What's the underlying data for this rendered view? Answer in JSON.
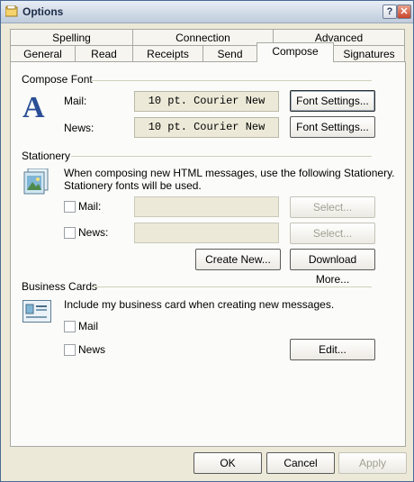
{
  "window": {
    "title": "Options",
    "help_glyph": "?",
    "close_glyph": "✕"
  },
  "tabs": {
    "row1": [
      "Spelling",
      "Connection",
      "Advanced"
    ],
    "row2": [
      "General",
      "Read",
      "Receipts",
      "Send",
      "Compose",
      "Signatures"
    ],
    "active": "Compose"
  },
  "compose_font": {
    "group_label": "Compose Font",
    "mail_label": "Mail:",
    "mail_font": "10 pt. Courier New",
    "news_label": "News:",
    "news_font": "10 pt. Courier New",
    "mail_settings_button": "Font Settings...",
    "news_settings_button": "Font Settings..."
  },
  "stationery": {
    "group_label": "Stationery",
    "description_line1": "When composing new HTML messages, use the following Stationery.",
    "description_line2": "Stationery fonts will be used.",
    "mail_label": "Mail:",
    "mail_value": "",
    "news_label": "News:",
    "news_value": "",
    "mail_select_button": "Select...",
    "news_select_button": "Select...",
    "create_new_button": "Create New...",
    "download_more_button": "Download More..."
  },
  "business_cards": {
    "group_label": "Business Cards",
    "description": "Include my business card when creating new messages.",
    "mail_label": "Mail",
    "news_label": "News",
    "edit_button": "Edit..."
  },
  "footer": {
    "ok": "OK",
    "cancel": "Cancel",
    "apply": "Apply"
  }
}
